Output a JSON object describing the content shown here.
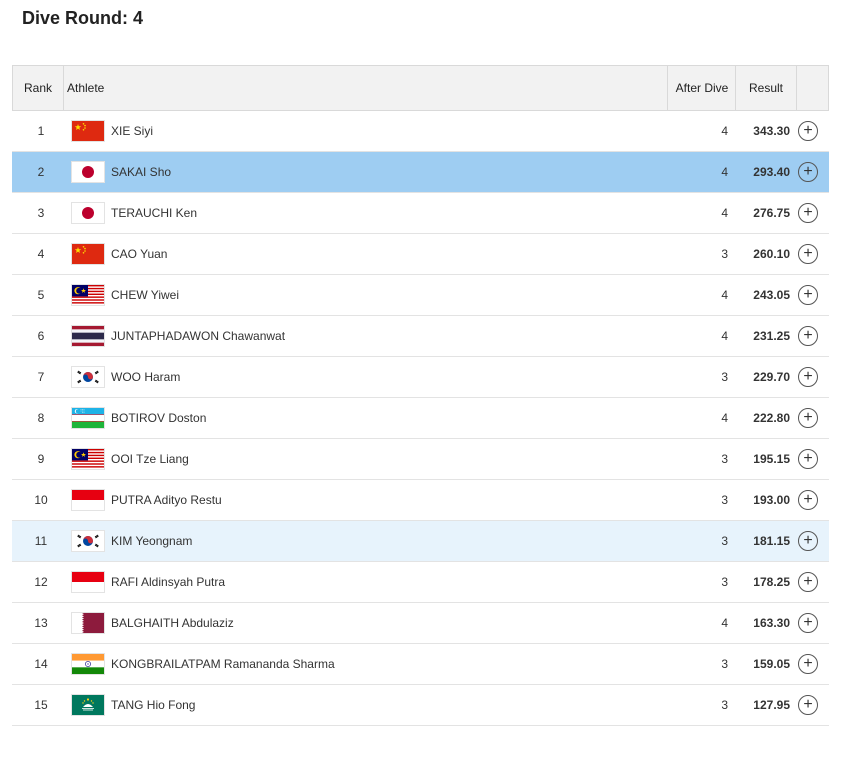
{
  "page": {
    "title": "Dive Round: 4"
  },
  "table": {
    "headers": {
      "rank": "Rank",
      "athlete": "Athlete",
      "after_dive": "After Dive",
      "result": "Result"
    },
    "expand_symbol": "+",
    "rows": [
      {
        "rank": "1",
        "name": "XIE Siyi",
        "after_dive": "4",
        "result": "343.30",
        "flag": "china",
        "highlight": "none"
      },
      {
        "rank": "2",
        "name": "SAKAI Sho",
        "after_dive": "4",
        "result": "293.40",
        "flag": "japan",
        "highlight": "strong"
      },
      {
        "rank": "3",
        "name": "TERAUCHI Ken",
        "after_dive": "4",
        "result": "276.75",
        "flag": "japan",
        "highlight": "none"
      },
      {
        "rank": "4",
        "name": "CAO Yuan",
        "after_dive": "3",
        "result": "260.10",
        "flag": "china",
        "highlight": "none"
      },
      {
        "rank": "5",
        "name": "CHEW Yiwei",
        "after_dive": "4",
        "result": "243.05",
        "flag": "malaysia",
        "highlight": "none"
      },
      {
        "rank": "6",
        "name": "JUNTAPHADAWON Chawanwat",
        "after_dive": "4",
        "result": "231.25",
        "flag": "thailand",
        "highlight": "none"
      },
      {
        "rank": "7",
        "name": "WOO Haram",
        "after_dive": "3",
        "result": "229.70",
        "flag": "korea",
        "highlight": "none"
      },
      {
        "rank": "8",
        "name": "BOTIROV Doston",
        "after_dive": "4",
        "result": "222.80",
        "flag": "uzbekistan",
        "highlight": "none"
      },
      {
        "rank": "9",
        "name": "OOI Tze Liang",
        "after_dive": "3",
        "result": "195.15",
        "flag": "malaysia",
        "highlight": "none"
      },
      {
        "rank": "10",
        "name": "PUTRA Adityo Restu",
        "after_dive": "3",
        "result": "193.00",
        "flag": "indonesia",
        "highlight": "none"
      },
      {
        "rank": "11",
        "name": "KIM Yeongnam",
        "after_dive": "3",
        "result": "181.15",
        "flag": "korea",
        "highlight": "light"
      },
      {
        "rank": "12",
        "name": "RAFI Aldinsyah Putra",
        "after_dive": "3",
        "result": "178.25",
        "flag": "indonesia",
        "highlight": "none"
      },
      {
        "rank": "13",
        "name": "BALGHAITH Abdulaziz",
        "after_dive": "4",
        "result": "163.30",
        "flag": "qatar",
        "highlight": "none"
      },
      {
        "rank": "14",
        "name": "KONGBRAILATPAM Ramananda Sharma",
        "after_dive": "3",
        "result": "159.05",
        "flag": "india",
        "highlight": "none"
      },
      {
        "rank": "15",
        "name": "TANG Hio Fong",
        "after_dive": "3",
        "result": "127.95",
        "flag": "macau",
        "highlight": "none"
      }
    ]
  },
  "colors": {
    "highlight_strong": "#9ecdf2",
    "highlight_light": "#e7f3fc",
    "header_bg": "#f2f2f2"
  }
}
